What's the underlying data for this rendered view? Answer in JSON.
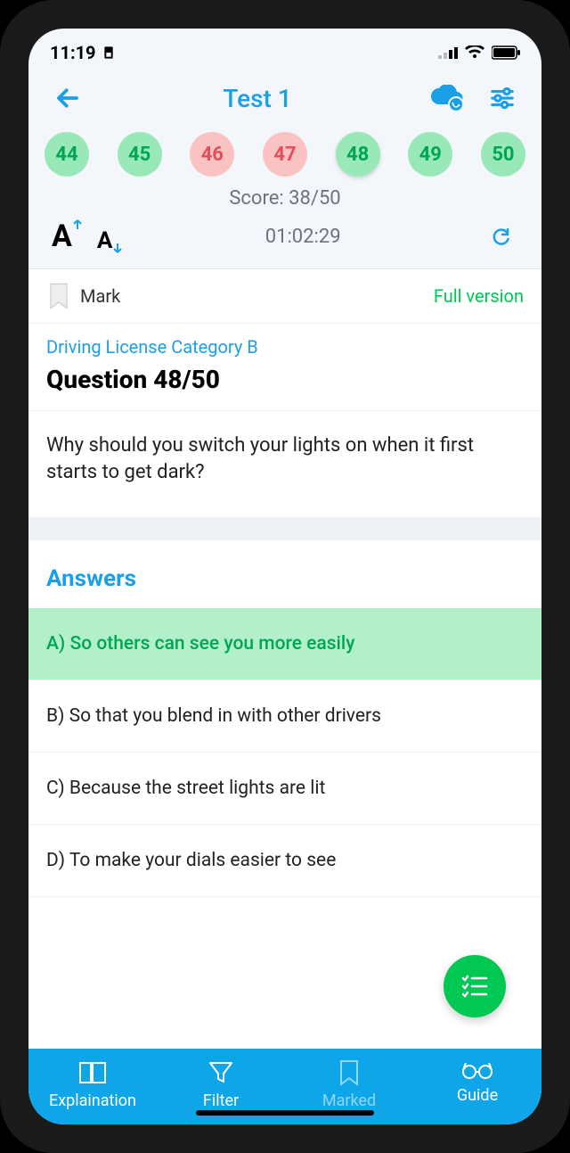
{
  "status": {
    "time": "11:19"
  },
  "header": {
    "title": "Test 1"
  },
  "questions_strip": [
    {
      "n": "44",
      "state": "correct"
    },
    {
      "n": "45",
      "state": "correct"
    },
    {
      "n": "46",
      "state": "wrong"
    },
    {
      "n": "47",
      "state": "wrong"
    },
    {
      "n": "48",
      "state": "current"
    },
    {
      "n": "49",
      "state": "correct"
    },
    {
      "n": "50",
      "state": "correct"
    }
  ],
  "score": "Score: 38/50",
  "timer": "01:02:29",
  "mark": {
    "label": "Mark",
    "full": "Full version"
  },
  "category": "Driving License Category B",
  "question_counter": "Question 48/50",
  "question_text": "Why should you switch your lights on when it first starts to get dark?",
  "answers_heading": "Answers",
  "answers": [
    {
      "text": "A) So others can see you more easily",
      "correct": true
    },
    {
      "text": "B) So that you blend in with other drivers",
      "correct": false
    },
    {
      "text": "C) Because the street lights are lit",
      "correct": false
    },
    {
      "text": "D) To make your dials easier to see",
      "correct": false
    }
  ],
  "nav": {
    "explanation": "Explaination",
    "filter": "Filter",
    "marked": "Marked",
    "guide": "Guide"
  },
  "colors": {
    "accent": "#1ba0e8",
    "green": "#00c853",
    "nav": "#0ea5e9"
  }
}
